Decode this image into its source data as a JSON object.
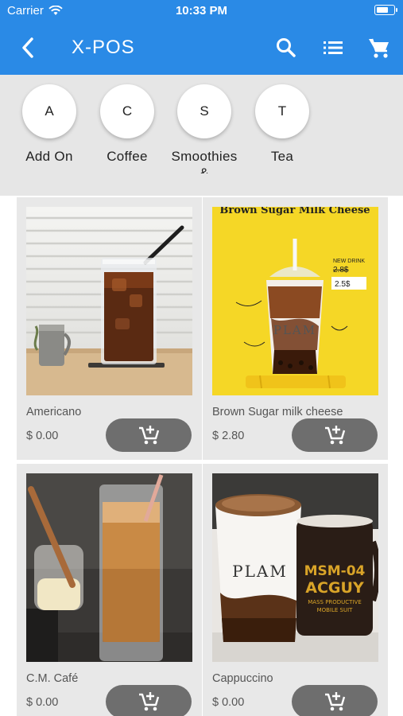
{
  "status_bar": {
    "carrier": "Carrier",
    "time": "10:33 PM",
    "battery_level": 0.75
  },
  "app_bar": {
    "title": "X-POS"
  },
  "categories": [
    {
      "initial": "A",
      "label": "Add On"
    },
    {
      "initial": "C",
      "label": "Coffee"
    },
    {
      "initial": "S",
      "label": "Smoothies &"
    },
    {
      "initial": "T",
      "label": "Tea"
    }
  ],
  "products": [
    {
      "name": "Americano",
      "price": "$ 0.00"
    },
    {
      "name": "Brown Sugar milk cheese",
      "price": "$ 2.80"
    },
    {
      "name": "C.M. Café",
      "price": "$ 0.00"
    },
    {
      "name": "Cappuccino",
      "price": "$ 0.00"
    }
  ],
  "promo": {
    "headline": "Brown Sugar Milk Cheese",
    "badge": "NEW DRINK",
    "old_price": "2.8$",
    "new_price": "2.5$",
    "brand": "PLAM"
  },
  "mug_text": {
    "line1": "MSM-04",
    "line2": "ACGUY",
    "line3": "MASS PRODUCTIVE",
    "line4": "MOBILE SUIT"
  },
  "colors": {
    "primary": "#2a8ae6",
    "button": "#6e6e6e",
    "card": "#e8e8e8"
  }
}
